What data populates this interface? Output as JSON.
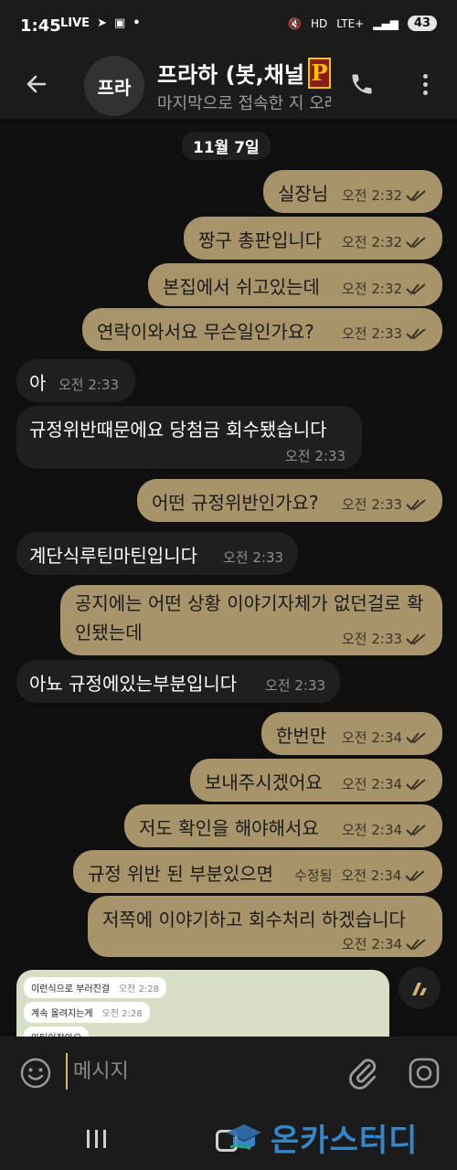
{
  "status_bar": {
    "time": "1:45",
    "live_label": "LIVE",
    "network": "LTE+",
    "battery": "43"
  },
  "header": {
    "avatar_initials": "프라",
    "title": "프라하 (봇,채널",
    "logo_letter": "P",
    "subtitle": "마지막으로 접속한 지 오래됨"
  },
  "date_chip": "11월 7일",
  "messages": [
    {
      "dir": "out",
      "text": "실장님",
      "time": "오전 2:32"
    },
    {
      "dir": "out",
      "text": "짱구 총판입니다",
      "time": "오전 2:32"
    },
    {
      "dir": "out",
      "text": "본집에서 쉬고있는데",
      "time": "오전 2:32"
    },
    {
      "dir": "out",
      "text": "연락이와서요 무슨일인가요?",
      "time": "오전 2:33"
    },
    {
      "dir": "in",
      "text": "아",
      "time": "오전 2:33"
    },
    {
      "dir": "in",
      "text": "규정위반때문에요 당첨금 회수됐습니다",
      "time": "오전 2:33"
    },
    {
      "dir": "out",
      "text": "어떤 규정위반인가요?",
      "time": "오전 2:33"
    },
    {
      "dir": "in",
      "text": "계단식루틴마틴입니다",
      "time": "오전 2:33"
    },
    {
      "dir": "out",
      "text": "공지에는 어떤 상황 이야기자체가 없던걸로 확인됐는데",
      "time": "오전 2:33"
    },
    {
      "dir": "in",
      "text": "아뇨 규정에있는부분입니다",
      "time": "오전 2:33"
    },
    {
      "dir": "out",
      "text": "한번만",
      "time": "오전 2:34"
    },
    {
      "dir": "out",
      "text": "보내주시겠어요",
      "time": "오전 2:34"
    },
    {
      "dir": "out",
      "text": "저도 확인을 해야해서요",
      "time": "오전 2:34"
    },
    {
      "dir": "out",
      "text": "규정 위반 된 부분있으면",
      "time": "오전 2:34",
      "edited": "수정됨"
    },
    {
      "dir": "out",
      "text": "저쪽에 이야기하고 회수처리 하겠습니다",
      "time": "오전 2:34"
    }
  ],
  "media_preview": {
    "lines": [
      {
        "text": "이런식으로 부러진걸",
        "time": "오전 2:28"
      },
      {
        "text": "계속 올려지는게",
        "time": "오전 2:28"
      },
      {
        "text": "마틴이잖아요",
        "time": ""
      }
    ]
  },
  "input": {
    "placeholder": "메시지"
  },
  "watermark": "온카스터디",
  "colors": {
    "out_bubble": "#a8946a",
    "in_bubble": "#1f1f1f",
    "background": "#0f0f0f"
  }
}
